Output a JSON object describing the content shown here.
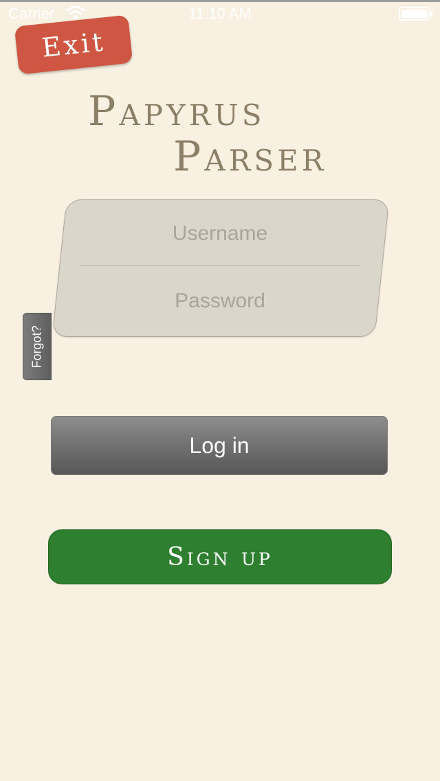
{
  "status_bar": {
    "carrier": "Carrier",
    "time": "11:10 AM",
    "wifi_icon": "wifi-icon",
    "battery_icon": "battery-icon"
  },
  "exit_button": {
    "label": "Exit",
    "color": "#cf5642"
  },
  "title": {
    "line1": "Papyrus",
    "line2": "Parser",
    "color": "#8c7f67"
  },
  "login_form": {
    "username_placeholder": "Username",
    "username_value": "",
    "password_placeholder": "Password",
    "password_value": ""
  },
  "forgot_tab": {
    "label": "Forgot?"
  },
  "login_button": {
    "label": "Log in"
  },
  "signup_button": {
    "label": "Sign up",
    "color": "#2e7f2f"
  },
  "background_color": "#f8f0e1"
}
